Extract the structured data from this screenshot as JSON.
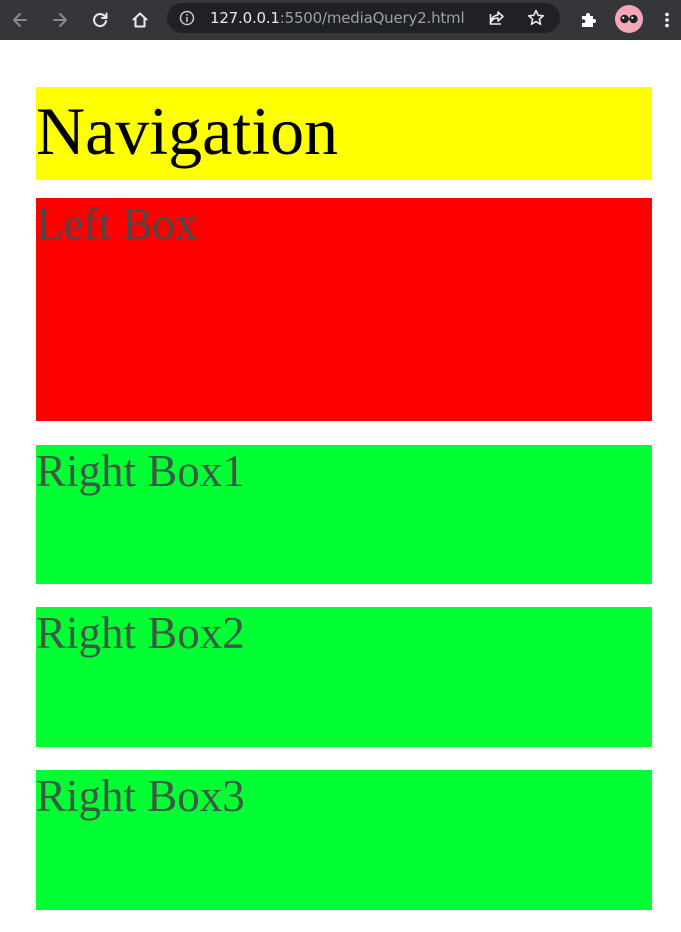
{
  "browser": {
    "url_host": "127.0.0.1",
    "url_rest": ":5500/mediaQuery2.html",
    "icons": {
      "back": "arrow-left-icon",
      "forward": "arrow-right-icon",
      "reload": "reload-icon",
      "home": "home-icon",
      "site_info": "info-icon",
      "share": "share-icon",
      "bookmark": "star-icon",
      "extensions": "puzzle-icon",
      "profile": "avatar",
      "menu": "kebab-menu-icon"
    }
  },
  "page": {
    "navigation": "Navigation",
    "left_box": "Left Box",
    "right_boxes": [
      "Right Box1",
      "Right Box2",
      "Right Box3"
    ],
    "colors": {
      "navigation_bg": "#ffff00",
      "left_box_bg": "#ff0000",
      "right_box_bg": "#00ff33"
    }
  }
}
